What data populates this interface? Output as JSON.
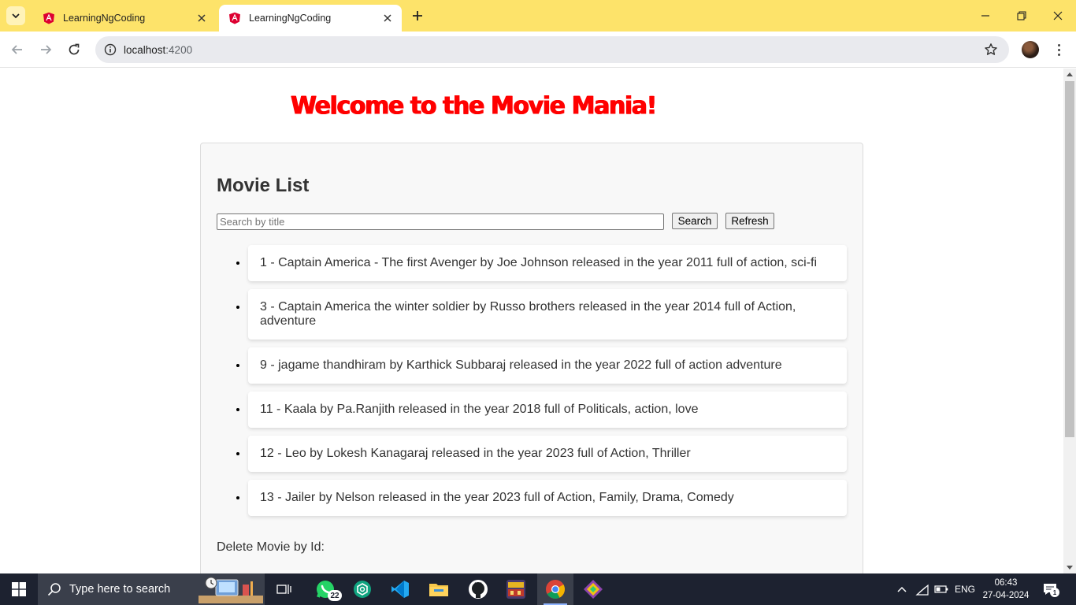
{
  "browser": {
    "tabs": [
      {
        "title": "LearningNgCoding",
        "active": false
      },
      {
        "title": "LearningNgCoding",
        "active": true
      }
    ],
    "address": {
      "host": "localhost",
      "port": ":4200"
    }
  },
  "page": {
    "welcome": "Welcome to the Movie Mania!",
    "heading": "Movie List",
    "search": {
      "placeholder": "Search by title",
      "value": ""
    },
    "buttons": {
      "search": "Search",
      "refresh": "Refresh"
    },
    "movies": [
      "1 - Captain America - The first Avenger by Joe Johnson released in the year 2011 full of action, sci-fi",
      "3 - Captain America the winter soldier by Russo brothers released in the year 2014 full of Action, adventure",
      "9 - jagame thandhiram by Karthick Subbaraj released in the year 2022 full of action adventure",
      "11 - Kaala by Pa.Ranjith released in the year 2018 full of Politicals, action, love",
      "12 - Leo by Lokesh Kanagaraj released in the year 2023 full of Action, Thriller",
      "13 - Jailer by Nelson released in the year 2023 full of Action, Family, Drama, Comedy"
    ],
    "delete_label": "Delete Movie by Id:"
  },
  "taskbar": {
    "search_placeholder": "Type here to search",
    "whatsapp_badge": "22",
    "language": "ENG",
    "time": "06:43",
    "date": "27-04-2024",
    "notification_count": "1"
  },
  "colors": {
    "tabstrip": "#fde36a",
    "welcome": "#ff0000",
    "taskbar": "#1d2230"
  }
}
